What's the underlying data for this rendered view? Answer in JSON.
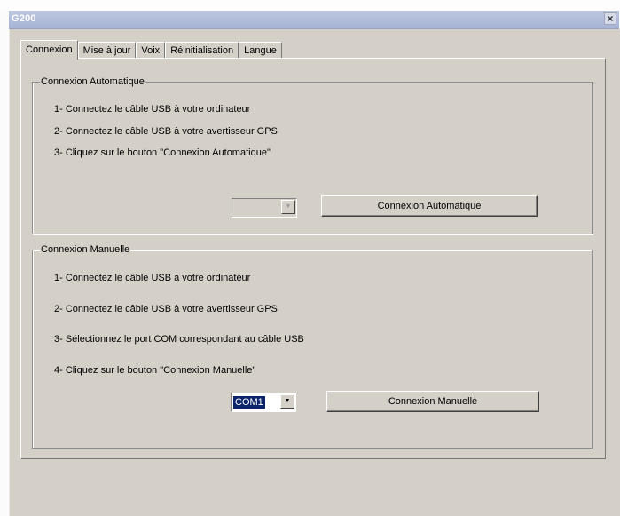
{
  "window": {
    "title": "G200",
    "close_label": "×"
  },
  "tabs": [
    "Connexion",
    "Mise à jour",
    "Voix",
    "Réinitialisation",
    "Langue"
  ],
  "auto": {
    "title": "Connexion Automatique",
    "steps": [
      "1- Connectez le câble USB à votre ordinateur",
      "2- Connectez le câble USB à votre avertisseur GPS",
      "3- Cliquez sur le bouton \"Connexion Automatique\""
    ],
    "combo_value": "",
    "button_label": "Connexion Automatique"
  },
  "manual": {
    "title": "Connexion Manuelle",
    "steps": [
      "1- Connectez le câble USB à votre ordinateur",
      "2- Connectez le câble USB à votre avertisseur GPS",
      "3- Sélectionnez le port COM correspondant au câble USB",
      "4- Cliquez sur le bouton \"Connexion Manuelle\""
    ],
    "combo_value": "COM1",
    "button_label": "Connexion Manuelle"
  }
}
